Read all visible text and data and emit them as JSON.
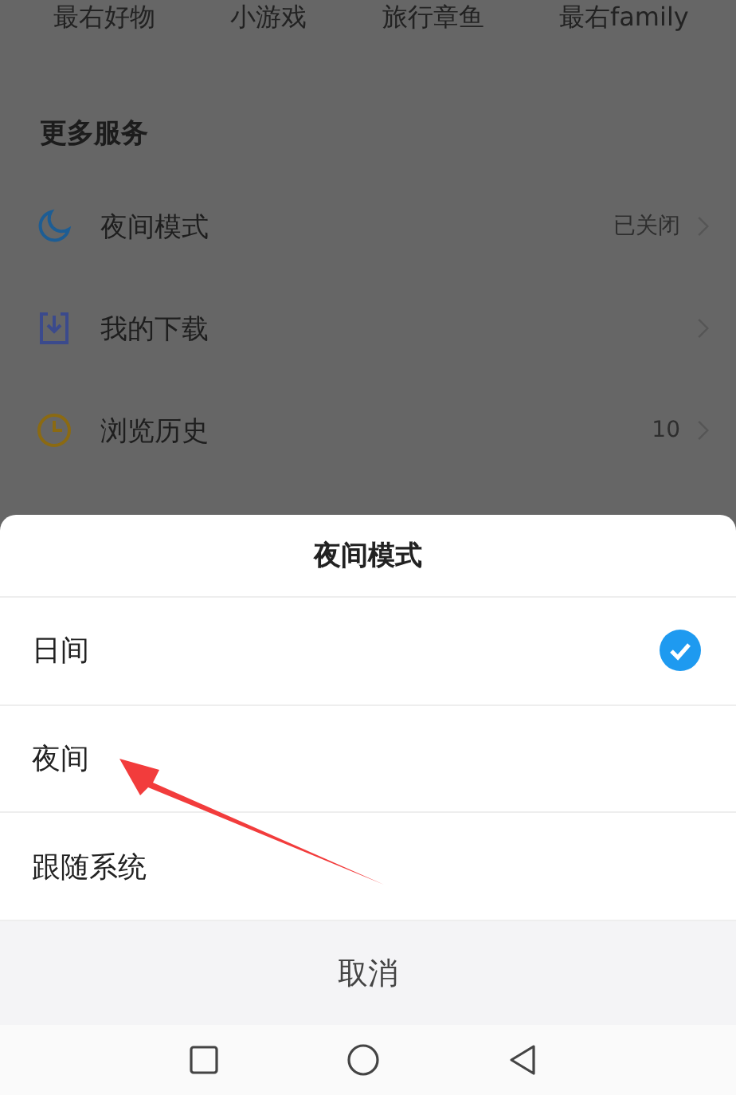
{
  "shortcuts": [
    "最右好物",
    "小游戏",
    "旅行章鱼",
    "最右family"
  ],
  "section_title": "更多服务",
  "services": [
    {
      "kind": "moon",
      "label": "夜间模式",
      "value": "已关闭"
    },
    {
      "kind": "download",
      "label": "我的下载"
    },
    {
      "kind": "clock",
      "label": "浏览历史",
      "value": "10"
    }
  ],
  "sheet": {
    "title": "夜间模式",
    "options": [
      {
        "label": "日间",
        "selected": true
      },
      {
        "label": "夜间",
        "selected": false
      },
      {
        "label": "跟随系统",
        "selected": false
      }
    ],
    "cancel": "取消"
  },
  "annotation": {
    "kind": "arrow"
  }
}
